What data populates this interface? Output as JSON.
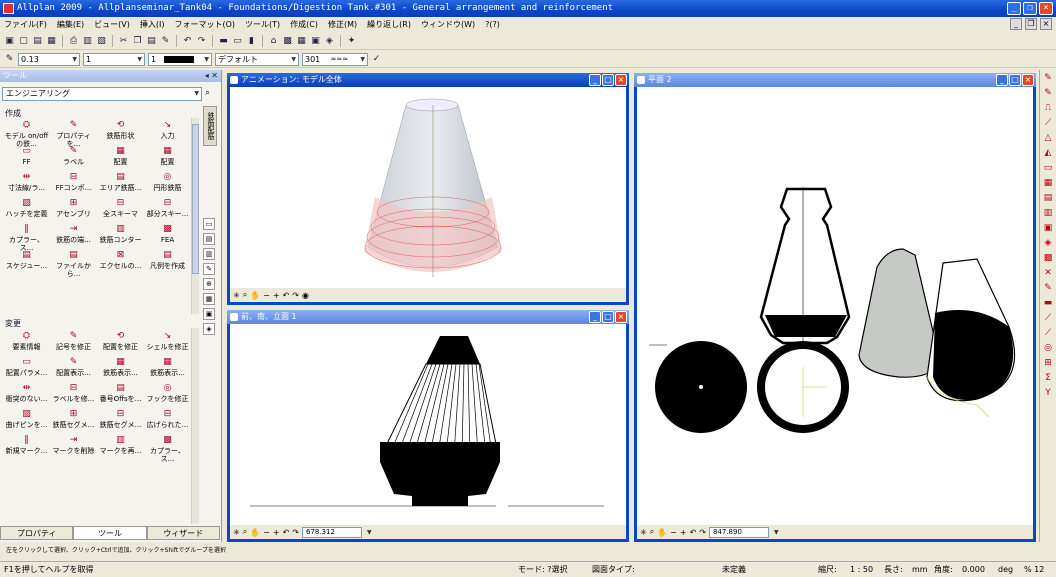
{
  "title": "Allplan 2009 - Allplanseminar_Tank04 - Foundations/Digestion Tank.#301 - General arrangement and reinforcement",
  "menu": [
    "ファイル(F)",
    "編集(E)",
    "ビュー(V)",
    "挿入(I)",
    "フォーマット(O)",
    "ツール(T)",
    "作成(C)",
    "修正(M)",
    "繰り返し(R)",
    "ウィンドウ(W)",
    "?(?)"
  ],
  "format_bar": {
    "pen": "0.13",
    "line": "1",
    "color": "1",
    "layer": "デフォルト",
    "style": "301"
  },
  "tool_panel": {
    "title": "ツール",
    "family": "エンジニアリング",
    "create_label": "作成",
    "create_items": [
      "モデル on/offの鉄...",
      "プロパティを...",
      "鉄筋形状",
      "入力",
      "FF",
      "ラベル",
      "配置",
      "配置",
      "寸法線/ラ...",
      "FFコンポ...",
      "エリア鉄筋...",
      "円形鉄筋",
      "ハッチを定義",
      "アセンブリ",
      "全スキーマ",
      "部分スキー...",
      "カプラー、ス...",
      "鉄筋の端...",
      "鉄筋コンター",
      "FEA",
      "スケジュー...",
      "ファイルから...",
      "エクセルの...",
      "凡例を作成"
    ],
    "modify_label": "変更",
    "modify_items": [
      "要素情報",
      "記号を修正",
      "配置を修正",
      "シェルを修正",
      "配置パラメ...",
      "配置表示...",
      "鉄筋表示...",
      "鉄筋表示...",
      "衝突のない...",
      "ラベルを修...",
      "番号Offsを...",
      "フックを修正",
      "曲げピンを...",
      "鉄筋セグメ...",
      "鉄筋セグメ...",
      "広げられた...",
      "新規マーク...",
      "マークを削除",
      "マークを再...",
      "カプラー、ス..."
    ],
    "tabs": [
      "プロパティ",
      "ツール",
      "ウィザード"
    ],
    "side_tab": "鉄筋配筋"
  },
  "windows": {
    "anim_title": "アニメーション: モデル全体",
    "elev_title": "前、南、立面 1",
    "plan_title": "平面 2",
    "elev_zoom": "678.312",
    "plan_zoom": "847.890"
  },
  "hint": "左をクリックして選択、クリック+Ctrlで追加、クリック+Shiftでグループを選択",
  "status": {
    "help": "F1を押してヘルプを取得",
    "mode": "モード: ?選択",
    "drawing_type_label": "図面タイプ:",
    "drawing_type": "未定義",
    "scale_label": "縮尺:",
    "scale": "1 : 50",
    "length_label": "長さ:",
    "length_unit": "mm",
    "angle_label": "角度:",
    "angle": "0.000",
    "angle_unit": "deg",
    "percent": "% 12"
  }
}
